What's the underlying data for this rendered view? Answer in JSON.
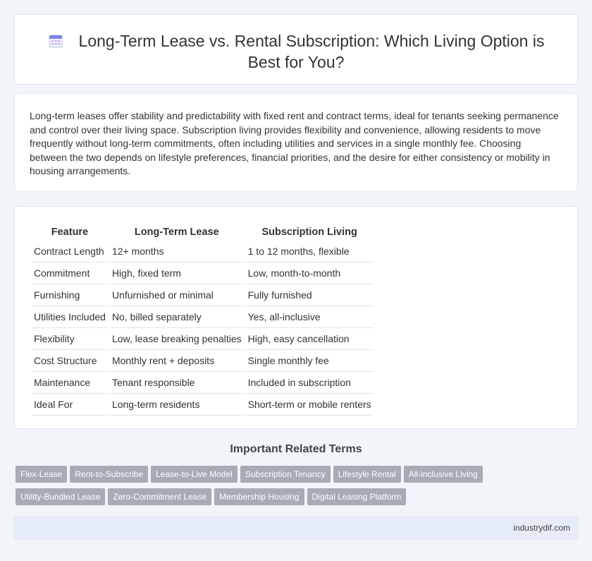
{
  "header": {
    "title": "Long-Term Lease vs. Rental Subscription: Which Living Option is Best for You?",
    "icon": "calendar-icon"
  },
  "intro": {
    "text": "Long-term leases offer stability and predictability with fixed rent and contract terms, ideal for tenants seeking permanence and control over their living space. Subscription living provides flexibility and convenience, allowing residents to move frequently without long-term commitments, often including utilities and services in a single monthly fee. Choosing between the two depends on lifestyle preferences, financial priorities, and the desire for either consistency or mobility in housing arrangements."
  },
  "table": {
    "headers": [
      "Feature",
      "Long-Term Lease",
      "Subscription Living"
    ],
    "rows": [
      [
        "Contract Length",
        "12+ months",
        "1 to 12 months, flexible"
      ],
      [
        "Commitment",
        "High, fixed term",
        "Low, month-to-month"
      ],
      [
        "Furnishing",
        "Unfurnished or minimal",
        "Fully furnished"
      ],
      [
        "Utilities Included",
        "No, billed separately",
        "Yes, all-inclusive"
      ],
      [
        "Flexibility",
        "Low, lease breaking penalties",
        "High, easy cancellation"
      ],
      [
        "Cost Structure",
        "Monthly rent + deposits",
        "Single monthly fee"
      ],
      [
        "Maintenance",
        "Tenant responsible",
        "Included in subscription"
      ],
      [
        "Ideal For",
        "Long-term residents",
        "Short-term or mobile renters"
      ]
    ]
  },
  "related": {
    "heading": "Important Related Terms",
    "tags": [
      "Flex-Lease",
      "Rent-to-Subscribe",
      "Lease-to-Live Model",
      "Subscription Tenancy",
      "Lifestyle Rental",
      "All-inclusive Living",
      "Utility-Bundled Lease",
      "Zero-Commitment Lease",
      "Membership Housing",
      "Digital Leasing Platform"
    ]
  },
  "footer": {
    "site": "industrydif.com"
  },
  "colors": {
    "background": "#f1f4f9",
    "tag": "#a6abb5",
    "footer": "#e6ecf7"
  }
}
